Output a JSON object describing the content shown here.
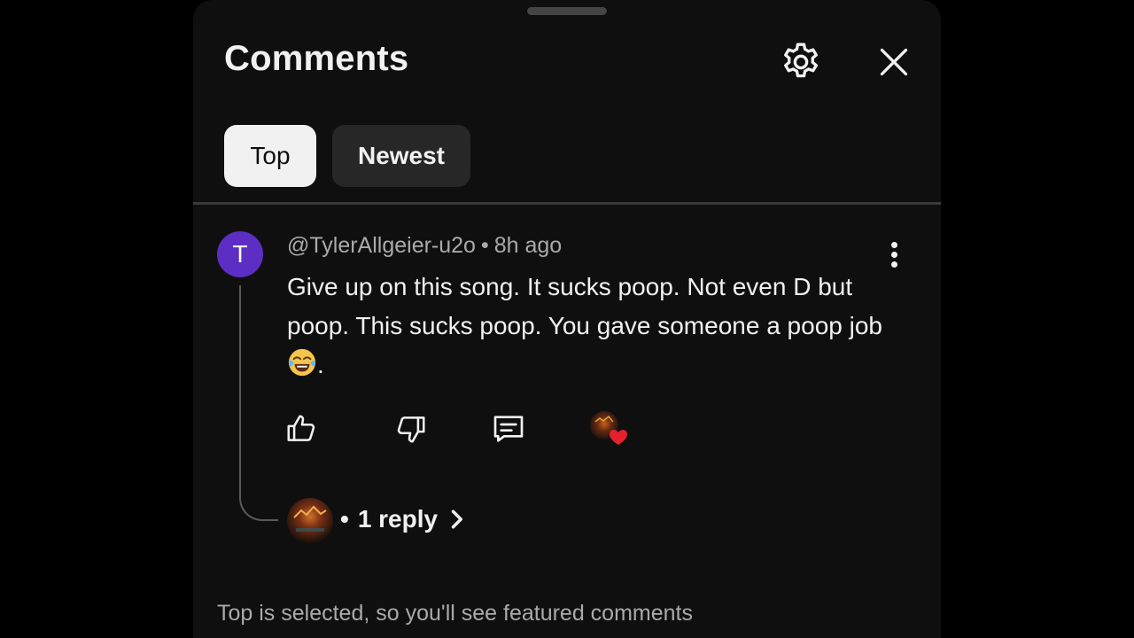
{
  "panel": {
    "title": "Comments",
    "settings_icon": "gear-icon",
    "close_icon": "close-icon"
  },
  "sort_chips": [
    {
      "label": "Top",
      "selected": true
    },
    {
      "label": "Newest",
      "selected": false
    }
  ],
  "comment": {
    "avatar_letter": "T",
    "avatar_color": "#5c2ec4",
    "author": "@TylerAllgeier-u2o",
    "separator": "•",
    "time": "8h ago",
    "text_part1": "Give up on this song. It sucks poop. Not even D but poop. This sucks poop. You gave someone a poop job",
    "emoji": "face-with-tears-of-joy",
    "text_part2": ".",
    "actions": {
      "like_icon": "thumb-up-icon",
      "dislike_icon": "thumb-down-icon",
      "reply_icon": "comment-icon",
      "creator_heart_color": "#e5212e"
    },
    "replies": {
      "bullet": "•",
      "label": "1 reply",
      "chevron_icon": "chevron-right-icon"
    }
  },
  "footer": {
    "note": "Top is selected, so you'll see featured comments"
  },
  "colors": {
    "background": "#0f0f0f",
    "text_primary": "#f1f1f1",
    "text_secondary": "#aaaaaa",
    "chip_inactive": "#272727"
  }
}
